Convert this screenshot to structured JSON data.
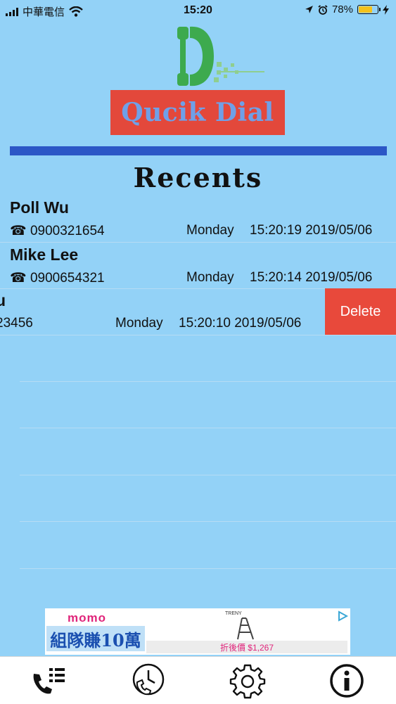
{
  "status": {
    "carrier": "中華電信",
    "time": "15:20",
    "battery_pct": "78%",
    "battery_level": 0.78
  },
  "app": {
    "title": "Qucik Dial"
  },
  "section": {
    "title": "Recents"
  },
  "recents": [
    {
      "name": "Poll Wu",
      "phone": "☎ 0900321654",
      "day": "Monday",
      "stamp": "15:20:19 2019/05/06"
    },
    {
      "name": "Mike Lee",
      "phone": "☎ 0900654321",
      "day": "Monday",
      "stamp": "15:20:14 2019/05/06"
    },
    {
      "name": "u",
      "phone": "23456",
      "day": "Monday",
      "stamp": "15:20:10 2019/05/06"
    }
  ],
  "actions": {
    "delete_label": "Delete"
  },
  "ad": {
    "brand": "momo",
    "promo": "組隊賺10萬",
    "product": "TRENY",
    "price": "折後價 $1,267"
  },
  "colors": {
    "background": "#93d2f7",
    "accent_bar": "#2c57c6",
    "logo_box": "#e3483b",
    "delete": "#e8493b"
  },
  "tabs": [
    {
      "icon": "dialer-list-icon"
    },
    {
      "icon": "recents-clock-icon"
    },
    {
      "icon": "settings-gear-icon"
    },
    {
      "icon": "info-icon"
    }
  ]
}
